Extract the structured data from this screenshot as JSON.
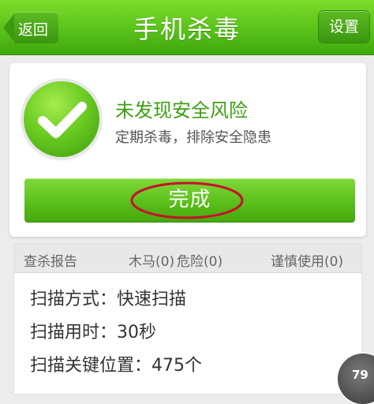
{
  "header": {
    "title": "手机杀毒",
    "back_label": "返回",
    "settings_label": "设置"
  },
  "result": {
    "title": "未发现安全风险",
    "subtitle": "定期杀毒，排除安全隐患",
    "done_label": "完成"
  },
  "report": {
    "title": "查杀报告",
    "trojan": "木马(0)",
    "danger": "危险(0)",
    "caution": "谨慎使用(0)",
    "rows": [
      "扫描方式：快速扫描",
      "扫描用时：30秒",
      "扫描关键位置：475个"
    ]
  },
  "floating": {
    "value": "79"
  },
  "colors": {
    "brand_green": "#59c21a",
    "status_green": "#3e9e13",
    "annotation_red": "#c8102e"
  },
  "icons": {
    "status": "check-icon",
    "back": "back-arrow-icon"
  }
}
